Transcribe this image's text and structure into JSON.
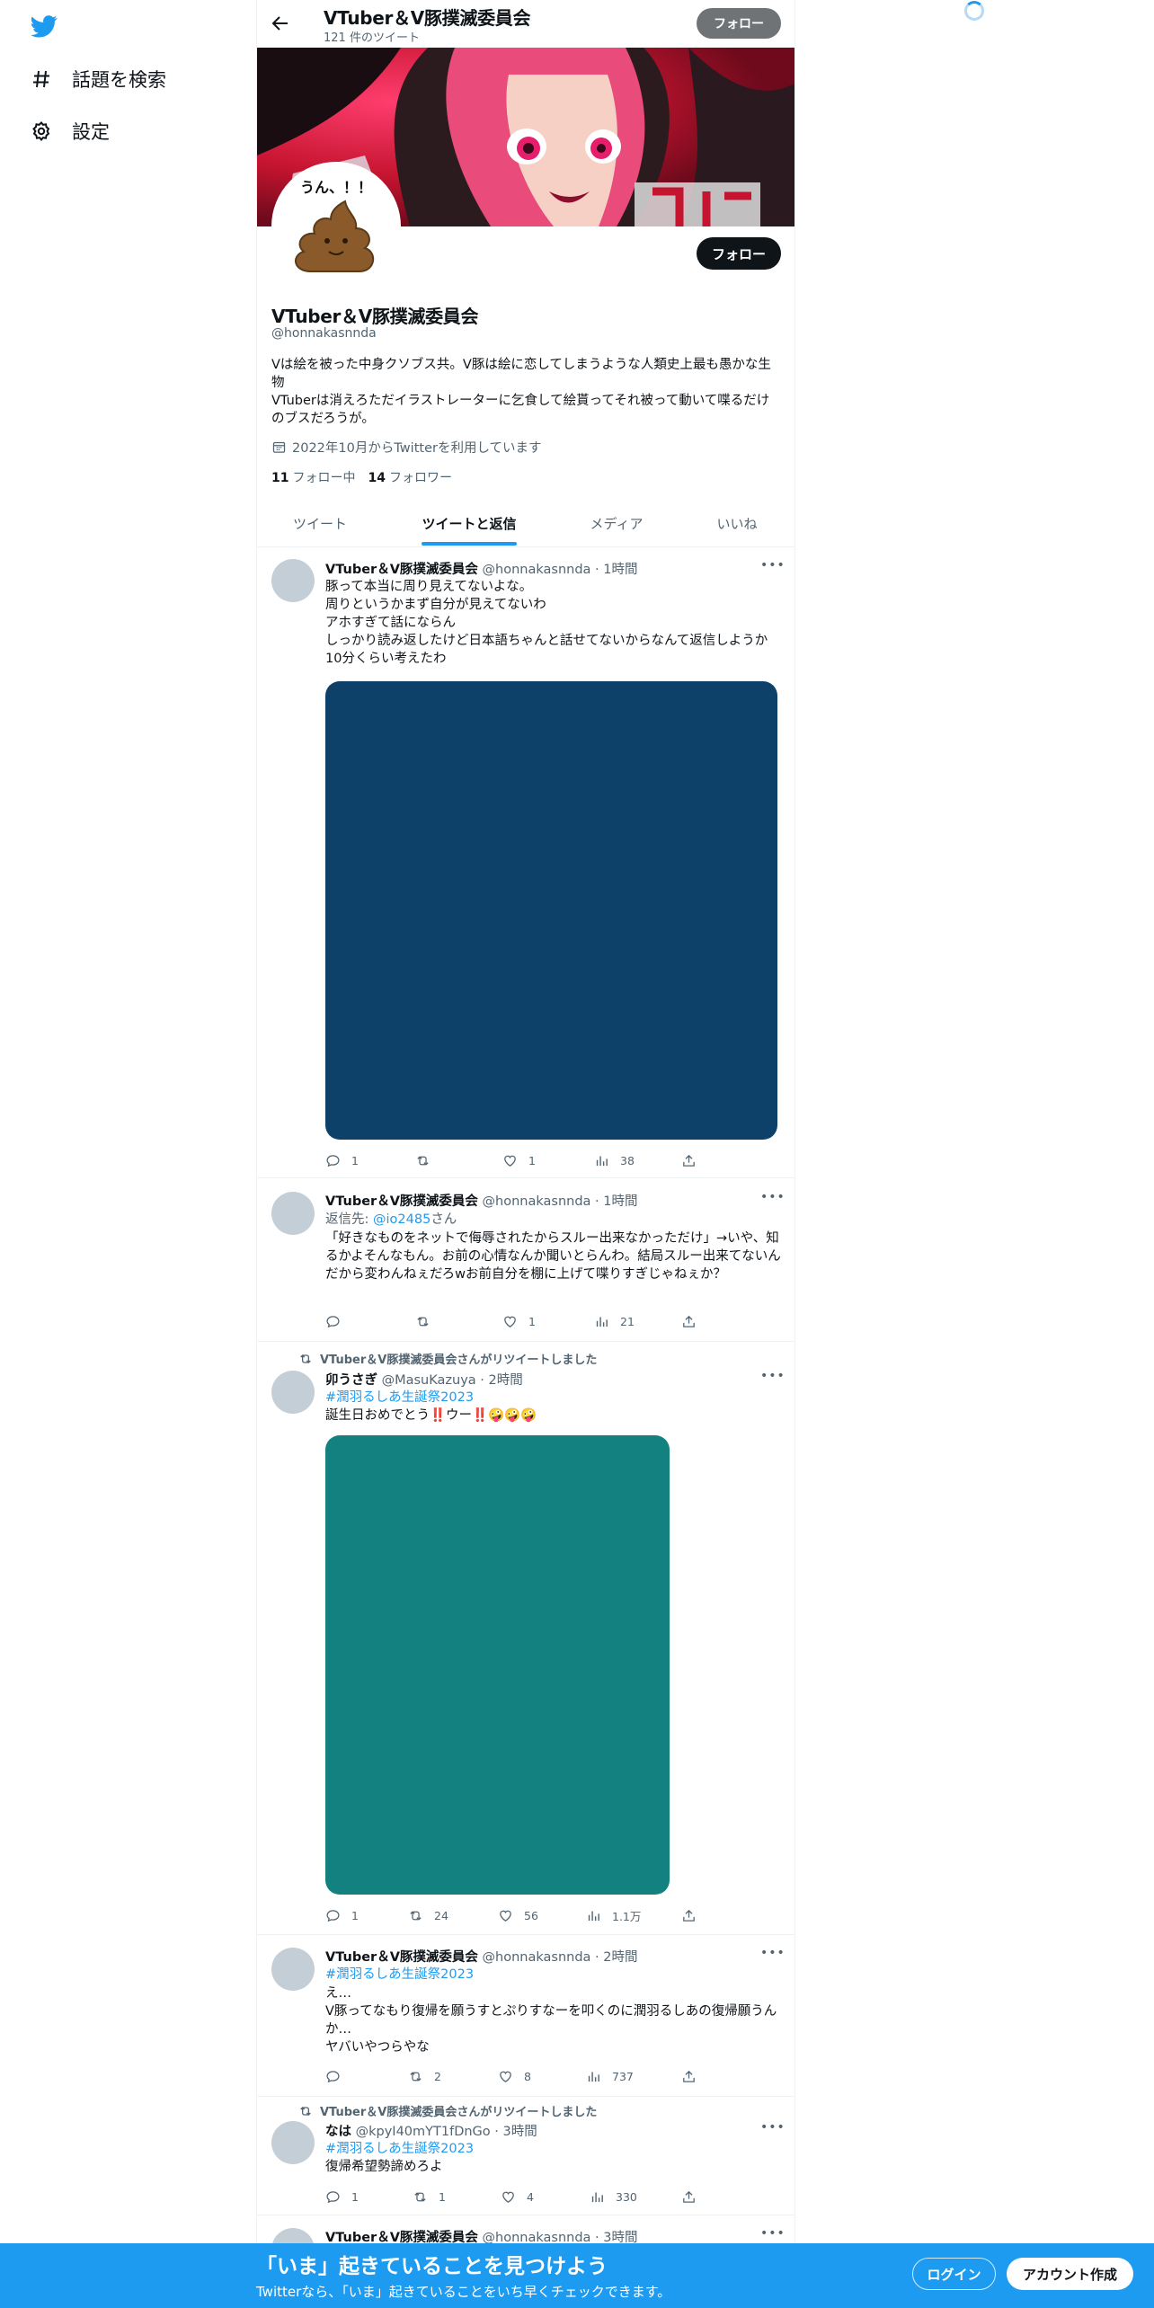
{
  "sidebar": {
    "items": [
      {
        "label": "話題を検索",
        "icon": "hashtag-icon"
      },
      {
        "label": "設定",
        "icon": "gear-icon"
      }
    ]
  },
  "header": {
    "name": "VTuber＆V豚撲滅委員会",
    "tweet_count": "121 件のツイート",
    "follow_label": "フォロー"
  },
  "profile": {
    "avatar_text": "うん、！！",
    "follow_label": "フォロー",
    "name": "VTuber＆V豚撲滅委員会",
    "handle": "@honnakasnnda",
    "bio_lines": [
      "Vは絵を被った中身クソブス共。V豚は絵に恋してしまうような人類史上最も愚かな生物",
      "VTuberは消えろただイラストレーターに乞食して絵貰ってそれ被って動いて喋るだけのブスだろうが。"
    ],
    "joined": "2022年10月からTwitterを利用しています",
    "following_count": "11",
    "following_label": "フォロー中",
    "followers_count": "14",
    "followers_label": "フォロワー"
  },
  "tabs": [
    {
      "label": "ツイート",
      "active": false
    },
    {
      "label": "ツイートと返信",
      "active": true
    },
    {
      "label": "メディア",
      "active": false
    },
    {
      "label": "いいね",
      "active": false
    }
  ],
  "tweets": [
    {
      "name": "VTuber＆V豚撲滅委員会",
      "handle": "@honnakasnnda",
      "time": "· 1時間",
      "lines": [
        "豚って本当に周り見えてないよな。",
        "周りというかまず自分が見えてないわ",
        "アホすぎて話にならん",
        "しっかり読み返したけど日本語ちゃんと話せてないからなんて返信しようか10分くらい考えたわ"
      ],
      "media_color": "#0e4169",
      "reply": "1",
      "retweet": "",
      "like": "1",
      "views": "38"
    },
    {
      "name": "VTuber＆V豚撲滅委員会",
      "handle": "@honnakasnnda",
      "time": "· 1時間",
      "reply_to_prefix": "返信先: ",
      "reply_to_handle": "@io2485",
      "reply_to_suffix": "さん",
      "text": "「好きなものをネットで侮辱されたからスルー出来なかっただけ」→いや、知るかよそんなもん。お前の心情なんか聞いとらんわ。結局スルー出来てないんだから変わんねぇだろwお前自分を棚に上げて喋りすぎじゃねぇか？",
      "reply": "",
      "retweet": "",
      "like": "1",
      "views": "21"
    },
    {
      "retweeted_by": "VTuber＆V豚撲滅委員会さんがリツイートしました",
      "name": "卯うさぎ",
      "handle": "@MasuKazuya",
      "time": "· 2時間",
      "hashtag": "#潤羽るしあ生誕祭2023",
      "text": "誕生日おめでとう‼️ウー‼️🤪🤪🤪",
      "media_color": "#138180",
      "reply": "1",
      "retweet": "24",
      "like": "56",
      "views": "1.1万"
    },
    {
      "name": "VTuber＆V豚撲滅委員会",
      "handle": "@honnakasnnda",
      "time": "· 2時間",
      "hashtag": "#潤羽るしあ生誕祭2023",
      "lines": [
        "え…",
        "V豚ってなもり復帰を願うすとぷりすなーを叩くのに潤羽るしあの復帰願うんか…",
        "ヤバいやつらやな"
      ],
      "reply": "",
      "retweet": "2",
      "like": "8",
      "views": "737"
    },
    {
      "retweeted_by": "VTuber＆V豚撲滅委員会さんがリツイートしました",
      "name": "なは",
      "handle": "@kpyI40mYT1fDnGo",
      "time": "· 3時間",
      "hashtag": "#潤羽るしあ生誕祭2023",
      "text": "復帰希望勢諦めろよ",
      "reply": "1",
      "retweet": "1",
      "like": "4",
      "views": "330"
    },
    {
      "name": "VTuber＆V豚撲滅委員会",
      "handle": "@honnakasnnda",
      "time": "· 3時間"
    }
  ],
  "bottom_bar": {
    "title": "「いま」起きていることを見つけよう",
    "subtitle": "Twitterなら、「いま」起きていることをいち早くチェックできます。",
    "login_label": "ログイン",
    "signup_label": "アカウント作成"
  },
  "colors": {
    "accent": "#1d9bf0",
    "text": "#0f1419",
    "secondary": "#536471"
  }
}
